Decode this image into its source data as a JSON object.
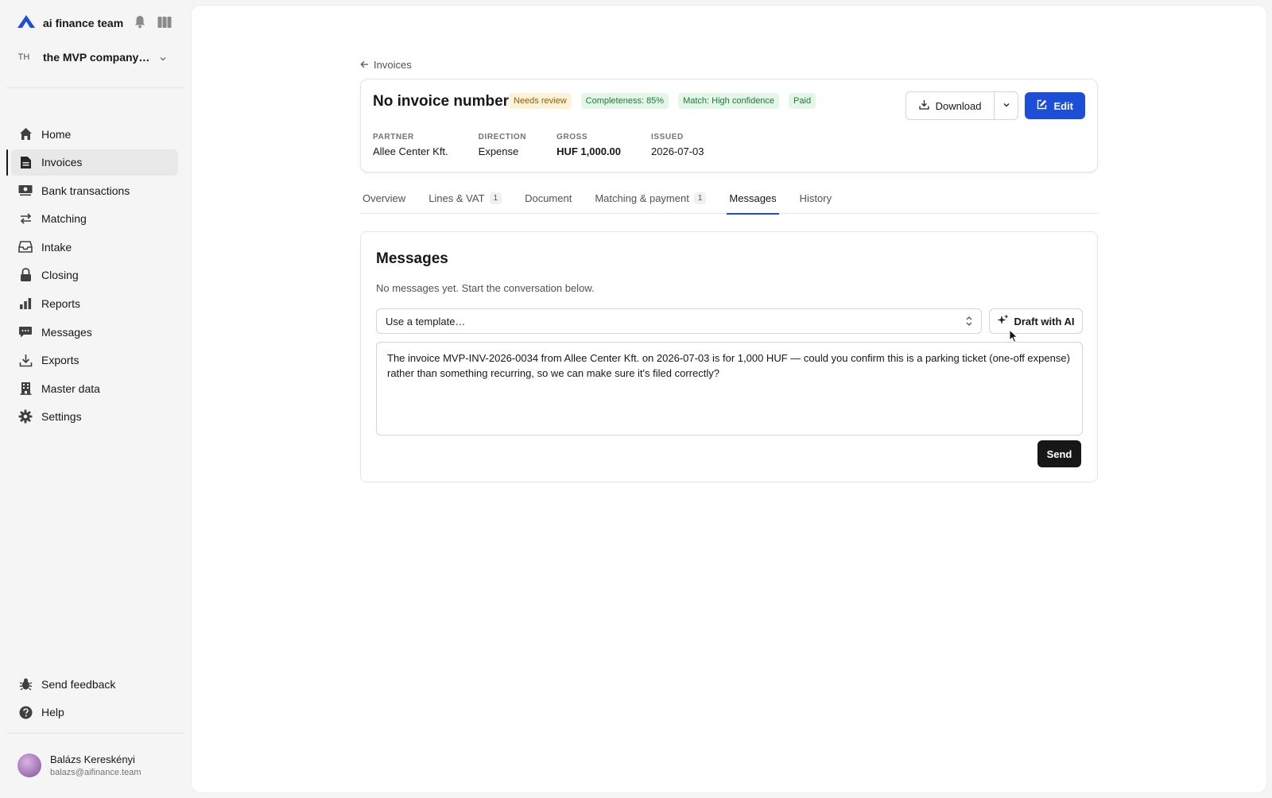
{
  "brand": {
    "name": "ai finance team",
    "accent": "#1d4ed8"
  },
  "org": {
    "initials": "TH",
    "name": "the MVP company…"
  },
  "nav": [
    {
      "label": "Home",
      "icon": "home-icon"
    },
    {
      "label": "Invoices",
      "icon": "document-icon",
      "active": true
    },
    {
      "label": "Bank transactions",
      "icon": "cash-icon"
    },
    {
      "label": "Matching",
      "icon": "arrows-icon"
    },
    {
      "label": "Intake",
      "icon": "inbox-icon"
    },
    {
      "label": "Closing",
      "icon": "lock-icon"
    },
    {
      "label": "Reports",
      "icon": "bar-chart-icon"
    },
    {
      "label": "Messages",
      "icon": "chat-icon"
    },
    {
      "label": "Exports",
      "icon": "download-icon"
    },
    {
      "label": "Master data",
      "icon": "building-icon"
    },
    {
      "label": "Settings",
      "icon": "gear-icon"
    }
  ],
  "bottom_nav": [
    {
      "label": "Send feedback",
      "icon": "bug-icon"
    },
    {
      "label": "Help",
      "icon": "help-icon"
    }
  ],
  "user": {
    "name": "Balázs Kereskényi",
    "email": "balazs@aifinance.team"
  },
  "back": {
    "label": "Invoices"
  },
  "invoice": {
    "title": "No invoice number",
    "badges": [
      {
        "label": "Needs review",
        "tone": "warn"
      },
      {
        "label": "Completeness: 85%",
        "tone": "ok"
      },
      {
        "label": "Match: High confidence",
        "tone": "ok"
      },
      {
        "label": "Paid",
        "tone": "ok"
      }
    ],
    "download_label": "Download",
    "edit_label": "Edit",
    "meta": [
      {
        "label": "PARTNER",
        "value": "Allee Center Kft."
      },
      {
        "label": "DIRECTION",
        "value": "Expense"
      },
      {
        "label": "GROSS",
        "value": "HUF 1,000.00",
        "bold": true
      },
      {
        "label": "ISSUED",
        "value": "2026-07-03"
      }
    ]
  },
  "tabs": [
    {
      "label": "Overview"
    },
    {
      "label": "Lines & VAT",
      "count": "1"
    },
    {
      "label": "Document"
    },
    {
      "label": "Matching & payment",
      "count": "1"
    },
    {
      "label": "Messages",
      "active": true
    },
    {
      "label": "History"
    }
  ],
  "messages": {
    "title": "Messages",
    "empty_text": "No messages yet. Start the conversation below.",
    "template_value": "Use a template…",
    "draft_label": "Draft with AI",
    "compose_text": "The invoice MVP-INV-2026-0034 from Allee Center Kft. on 2026-07-03 is for 1,000 HUF — could you confirm this is a parking ticket (one-off expense) rather than something recurring, so we can make sure it's filed correctly?",
    "send_label": "Send"
  }
}
